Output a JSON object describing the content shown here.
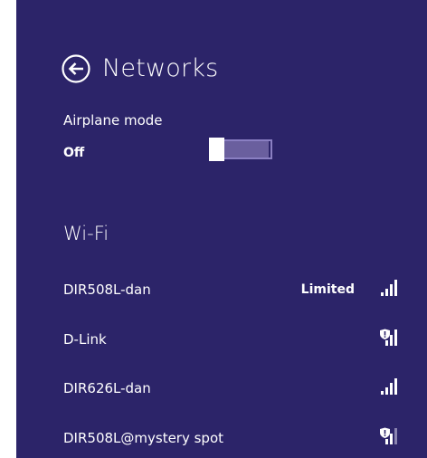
{
  "header": {
    "title": "Networks",
    "back_icon": "back-arrow-circle-icon"
  },
  "airplane_mode": {
    "label": "Airplane mode",
    "state": "Off",
    "on": false
  },
  "wifi": {
    "heading": "Wi-Fi",
    "networks": [
      {
        "name": "DIR508L-dan",
        "status": "Limited",
        "secured": false,
        "signal_bars": 4,
        "icon": "signal-icon"
      },
      {
        "name": "D-Link",
        "status": "",
        "secured": true,
        "signal_bars": 4,
        "icon": "secured-signal-icon"
      },
      {
        "name": "DIR626L-dan",
        "status": "",
        "secured": false,
        "signal_bars": 4,
        "icon": "signal-icon"
      },
      {
        "name": "DIR508L@mystery spot",
        "status": "",
        "secured": true,
        "signal_bars": 3,
        "icon": "secured-signal-icon"
      }
    ]
  },
  "colors": {
    "background": "#2c2469",
    "text": "#ffffff",
    "toggle_fill": "#6a5f9e",
    "dim_bar": "#8a84b0"
  }
}
